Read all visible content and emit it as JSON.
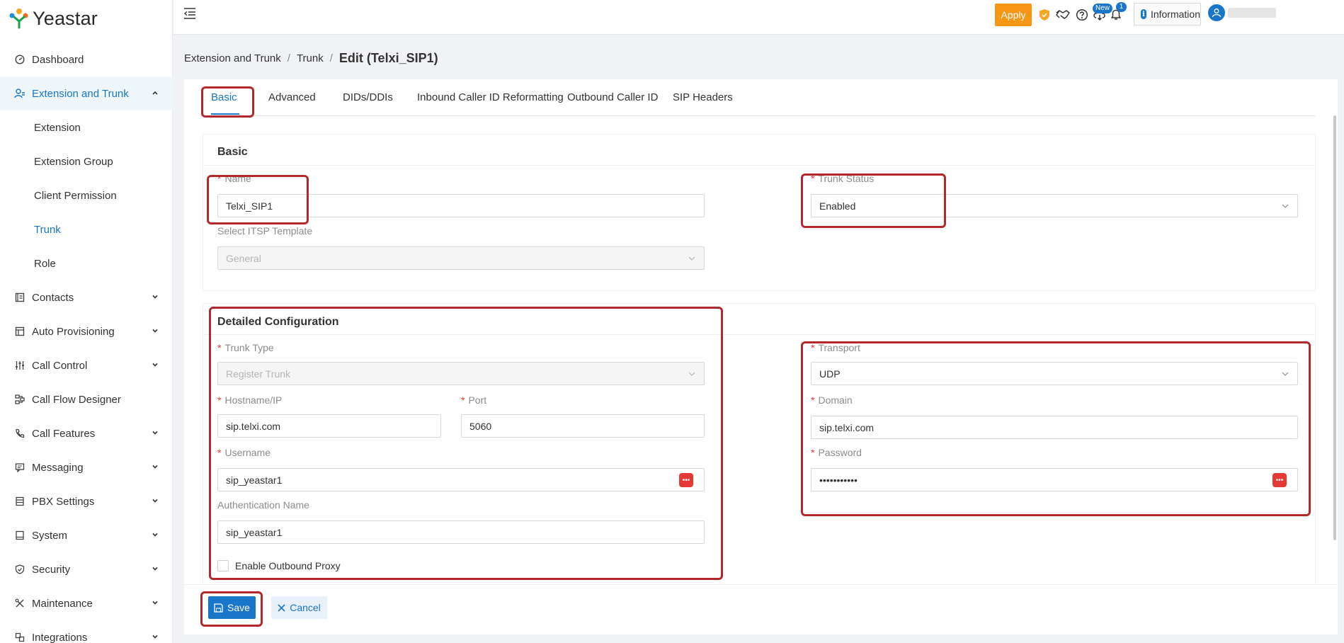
{
  "app": {
    "logo_text": "Yeastar"
  },
  "sidebar": {
    "items": [
      {
        "label": "Dashboard",
        "icon": "dashboard-icon"
      },
      {
        "label": "Extension and Trunk",
        "icon": "users-icon",
        "expanded": true
      },
      {
        "label": "Contacts",
        "icon": "contacts-icon"
      },
      {
        "label": "Auto Provisioning",
        "icon": "provisioning-icon"
      },
      {
        "label": "Call Control",
        "icon": "sliders-icon"
      },
      {
        "label": "Call Flow Designer",
        "icon": "flow-icon"
      },
      {
        "label": "Call Features",
        "icon": "phone-icon"
      },
      {
        "label": "Messaging",
        "icon": "message-icon"
      },
      {
        "label": "PBX Settings",
        "icon": "settings-icon"
      },
      {
        "label": "System",
        "icon": "monitor-icon"
      },
      {
        "label": "Security",
        "icon": "shield-icon"
      },
      {
        "label": "Maintenance",
        "icon": "tools-icon"
      },
      {
        "label": "Integrations",
        "icon": "integrations-icon"
      }
    ],
    "sub_items": [
      "Extension",
      "Extension Group",
      "Client Permission",
      "Trunk",
      "Role"
    ],
    "active_sub": "Trunk"
  },
  "header": {
    "apply_label": "Apply",
    "new_badge": "New",
    "notification_count": "1",
    "information_label": "Information"
  },
  "breadcrumb": {
    "items": [
      "Extension and Trunk",
      "Trunk"
    ],
    "current": "Edit (Telxi_SIP1)"
  },
  "tabs": [
    "Basic",
    "Advanced",
    "DIDs/DDIs",
    "Inbound Caller ID Reformatting",
    "Outbound Caller ID",
    "SIP Headers"
  ],
  "active_tab": "Basic",
  "basic": {
    "title": "Basic",
    "name_label": "Name",
    "name_value": "Telxi_SIP1",
    "trunk_status_label": "Trunk Status",
    "trunk_status_value": "Enabled",
    "itsp_label": "Select ITSP Template",
    "itsp_value": "General"
  },
  "detailed": {
    "title": "Detailed Configuration",
    "trunk_type_label": "Trunk Type",
    "trunk_type_value": "Register Trunk",
    "hostname_label": "Hostname/IP",
    "hostname_value": "sip.telxi.com",
    "port_label": "Port",
    "port_value": "5060",
    "username_label": "Username",
    "username_value": "sip_yeastar1",
    "auth_name_label": "Authentication Name",
    "auth_name_value": "sip_yeastar1",
    "outbound_proxy_label": "Enable Outbound Proxy",
    "transport_label": "Transport",
    "transport_value": "UDP",
    "domain_label": "Domain",
    "domain_value": "sip.telxi.com",
    "password_label": "Password",
    "password_value": "•••••••••••"
  },
  "footer": {
    "save_label": "Save",
    "cancel_label": "Cancel"
  },
  "colors": {
    "accent": "#1976c8",
    "apply": "#f79515",
    "required": "#e53935",
    "highlight": "#b3282d"
  }
}
